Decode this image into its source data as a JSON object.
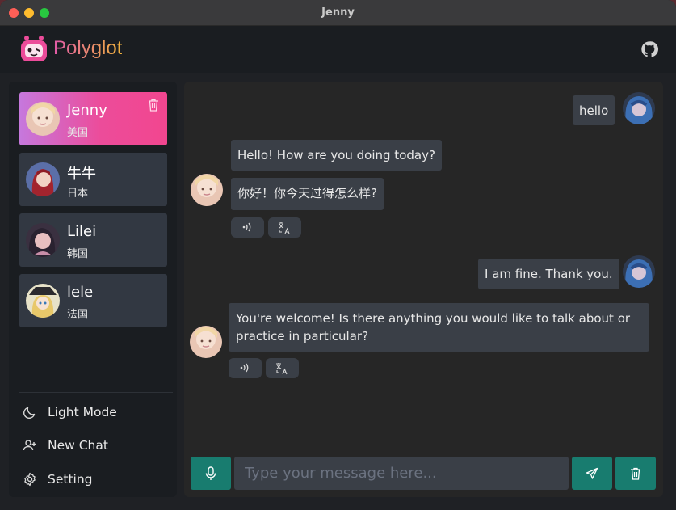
{
  "window": {
    "title": "Jenny"
  },
  "header": {
    "brand": "Polyglot",
    "logo_icon": "robot-icon",
    "github_icon": "github-icon"
  },
  "contacts": [
    {
      "name": "Jenny",
      "country": "美国",
      "active": true
    },
    {
      "name": "牛牛",
      "country": "日本",
      "active": false
    },
    {
      "name": "Lilei",
      "country": "韩国",
      "active": false
    },
    {
      "name": "lele",
      "country": "法国",
      "active": false
    }
  ],
  "sidebar_menu": {
    "light_mode": "Light Mode",
    "new_chat": "New Chat",
    "setting": "Setting"
  },
  "messages": [
    {
      "role": "user",
      "text": "hello"
    },
    {
      "role": "assistant",
      "text": "Hello! How are you doing today?",
      "translation": "你好！你今天过得怎么样?"
    },
    {
      "role": "user",
      "text": "I am fine. Thank you."
    },
    {
      "role": "assistant",
      "text": "You're welcome! Is there anything you would like to talk about or practice in particular?"
    }
  ],
  "composer": {
    "placeholder": "Type your message here..."
  },
  "colors": {
    "accent": "#187c6f",
    "active_gradient_start": "#c678dd",
    "active_gradient_end": "#f2468f",
    "bubble": "#3a3f47"
  }
}
